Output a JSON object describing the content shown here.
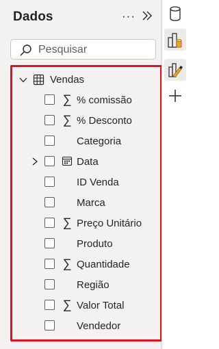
{
  "pane": {
    "title": "Dados",
    "more_label": "···",
    "search": {
      "placeholder": "Pesquisar",
      "value": ""
    }
  },
  "table": {
    "name": "Vendas",
    "expanded": true,
    "fields": [
      {
        "label": "% comissão",
        "icon": "sigma-icon",
        "expandable": false,
        "checked": false
      },
      {
        "label": "% Desconto",
        "icon": "sigma-icon",
        "expandable": false,
        "checked": false
      },
      {
        "label": "Categoria",
        "icon": "",
        "expandable": false,
        "checked": false
      },
      {
        "label": "Data",
        "icon": "calendar-icon",
        "expandable": true,
        "checked": false
      },
      {
        "label": "ID Venda",
        "icon": "",
        "expandable": false,
        "checked": false
      },
      {
        "label": "Marca",
        "icon": "",
        "expandable": false,
        "checked": false
      },
      {
        "label": "Preço Unitário",
        "icon": "sigma-icon",
        "expandable": false,
        "checked": false
      },
      {
        "label": "Produto",
        "icon": "",
        "expandable": false,
        "checked": false
      },
      {
        "label": "Quantidade",
        "icon": "sigma-icon",
        "expandable": false,
        "checked": false
      },
      {
        "label": "Região",
        "icon": "",
        "expandable": false,
        "checked": false
      },
      {
        "label": "Valor Total",
        "icon": "sigma-icon",
        "expandable": false,
        "checked": false
      },
      {
        "label": "Vendedor",
        "icon": "",
        "expandable": false,
        "checked": false
      }
    ]
  },
  "rail": {
    "buttons": [
      {
        "name": "data-pane-icon",
        "active": false
      },
      {
        "name": "build-visual-icon",
        "active": true
      },
      {
        "name": "format-visual-icon",
        "active": true
      },
      {
        "name": "add-icon",
        "active": false
      }
    ]
  },
  "colors": {
    "highlight_border": "#e3101f",
    "pane_background": "#f3f2f1",
    "accent_orange": "#e8a33d"
  }
}
